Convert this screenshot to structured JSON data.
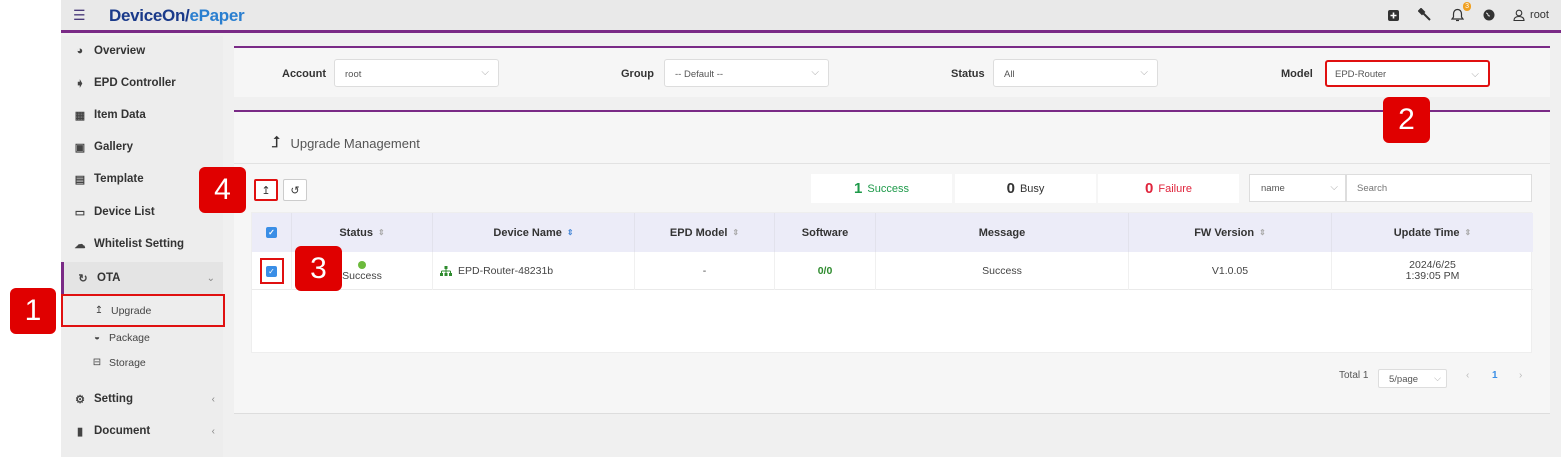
{
  "header": {
    "brand_main": "DeviceOn/",
    "brand_accent": "ePaper",
    "notification_count": "3",
    "user": "root"
  },
  "sidebar": {
    "items": [
      {
        "label": "Overview",
        "icon": "dashboard-icon"
      },
      {
        "label": "EPD Controller",
        "icon": "tag-icon"
      },
      {
        "label": "Item Data",
        "icon": "table-icon"
      },
      {
        "label": "Gallery",
        "icon": "image-icon"
      },
      {
        "label": "Template",
        "icon": "id-card-icon"
      },
      {
        "label": "Device List",
        "icon": "monitor-icon"
      },
      {
        "label": "Whitelist Setting",
        "icon": "cloud-icon"
      },
      {
        "label": "OTA",
        "icon": "sync-icon"
      },
      {
        "label": "Setting",
        "icon": "gears-icon"
      },
      {
        "label": "Document",
        "icon": "book-icon"
      }
    ],
    "ota_sub": [
      {
        "label": "Upgrade",
        "icon": "upload-icon"
      },
      {
        "label": "Package",
        "icon": "inbox-icon"
      },
      {
        "label": "Storage",
        "icon": "hdd-icon"
      }
    ]
  },
  "filters": {
    "account_label": "Account",
    "account_value": "root",
    "group_label": "Group",
    "group_value": "-- Default --",
    "status_label": "Status",
    "status_value": "All",
    "model_label": "Model",
    "model_value": "EPD-Router"
  },
  "panel": {
    "title": "Upgrade Management"
  },
  "stats": {
    "success_count": "1",
    "success_label": "Success",
    "busy_count": "0",
    "busy_label": "Busy",
    "failure_count": "0",
    "failure_label": "Failure"
  },
  "search": {
    "field": "name",
    "placeholder": "Search"
  },
  "table": {
    "columns": [
      "Status",
      "Device Name",
      "EPD Model",
      "Software",
      "Message",
      "FW Version",
      "Update Time"
    ],
    "rows": [
      {
        "status": "Success",
        "device_name": "EPD-Router-48231b",
        "epd_model": "-",
        "software": "0/0",
        "message": "Success",
        "fw_version": "V1.0.05",
        "update_date": "2024/6/25",
        "update_time": "1:39:05 PM"
      }
    ]
  },
  "pagination": {
    "total": "Total 1",
    "page_size": "5/page",
    "current_page": "1"
  },
  "callouts": [
    "1",
    "2",
    "3",
    "4"
  ],
  "colors": {
    "accent": "#7a2a86",
    "success": "#1e9a4a",
    "failure": "#e0243c",
    "highlight": "#e00000"
  }
}
